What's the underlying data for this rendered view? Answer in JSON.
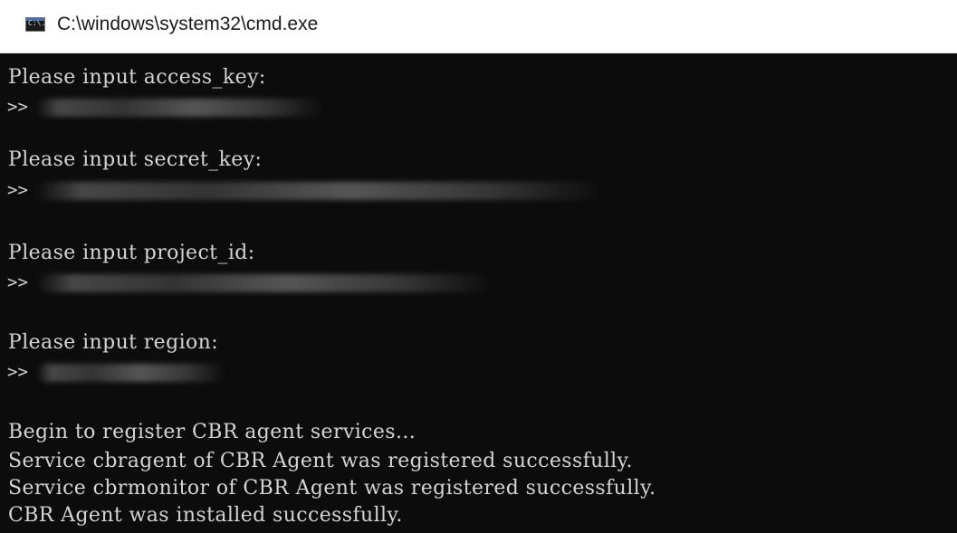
{
  "window": {
    "title": "C:\\windows\\system32\\cmd.exe",
    "icon": "cmd-icon",
    "icon_text": "C:\\."
  },
  "console": {
    "prompts": [
      {
        "label": "Please input access_key:",
        "marker": ">>"
      },
      {
        "label": "Please input secret_key:",
        "marker": ">>"
      },
      {
        "label": "Please input project_id:",
        "marker": ">>"
      },
      {
        "label": "Please input region:",
        "marker": ">>"
      }
    ],
    "output": [
      "Begin to register CBR agent services...",
      "Service cbragent of CBR Agent was registered successfully.",
      "Service cbrmonitor of CBR Agent was registered successfully.",
      "CBR Agent was installed successfully."
    ]
  },
  "colors": {
    "console_background": "#0c0c0c",
    "console_text": "#d4d4d4",
    "titlebar_background": "#ffffff"
  }
}
